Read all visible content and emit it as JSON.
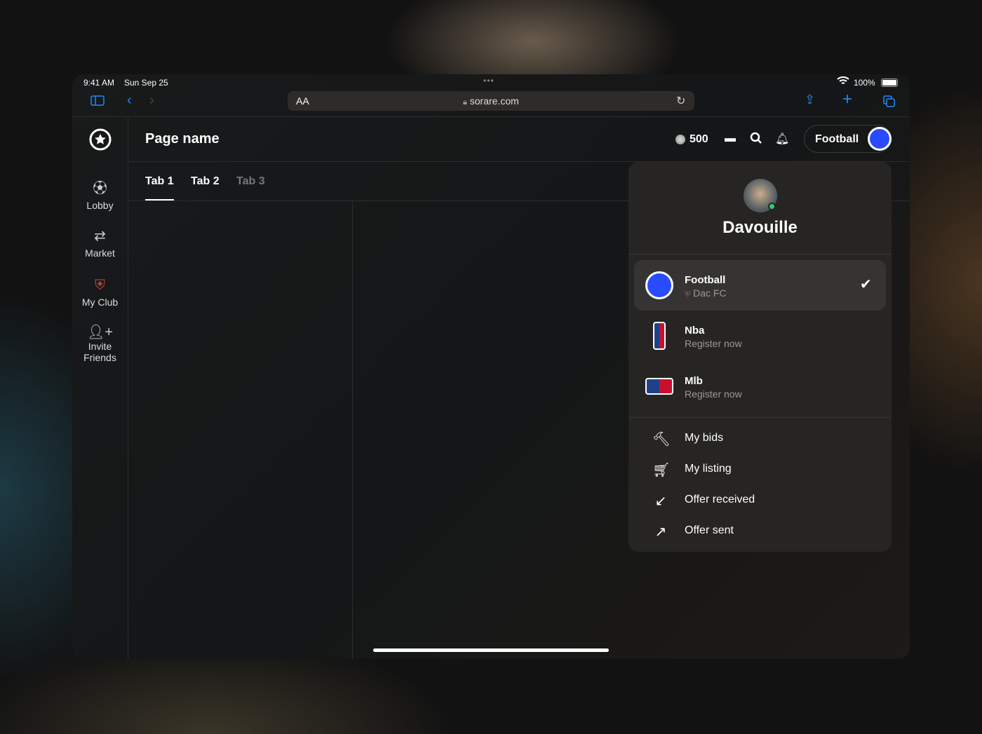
{
  "status_bar": {
    "time": "9:41 AM",
    "date": "Sun Sep 25",
    "battery": "100%"
  },
  "browser": {
    "text_size": "AA",
    "url": "sorare.com"
  },
  "sidebar": {
    "items": [
      {
        "label": "Lobby",
        "icon": "stadium-icon"
      },
      {
        "label": "Market",
        "icon": "swap-icon"
      },
      {
        "label": "My Club",
        "icon": "club-crest-icon"
      },
      {
        "label": "Invite Friends",
        "icon": "add-user-icon"
      }
    ]
  },
  "header": {
    "title": "Page name",
    "coins": "500",
    "sport_button": "Football"
  },
  "tabs": [
    {
      "label": "Tab 1",
      "active": true
    },
    {
      "label": "Tab 2"
    },
    {
      "label": "Tab 3",
      "disabled": true
    }
  ],
  "dropdown": {
    "username": "Davouille",
    "sports": [
      {
        "name": "Football",
        "sub": "Dac FC",
        "selected": true
      },
      {
        "name": "Nba",
        "sub": "Register now"
      },
      {
        "name": "Mlb",
        "sub": "Register now"
      }
    ],
    "menu": [
      {
        "label": "My bids",
        "icon": "gavel-icon"
      },
      {
        "label": "My listing",
        "icon": "cart-icon"
      },
      {
        "label": "Offer received",
        "icon": "arrow-down-left-icon"
      },
      {
        "label": "Offer sent",
        "icon": "arrow-up-right-icon"
      }
    ]
  },
  "colors": {
    "accent": "#1a8cff",
    "football": "#2a4bff",
    "online": "#2ecc71"
  }
}
